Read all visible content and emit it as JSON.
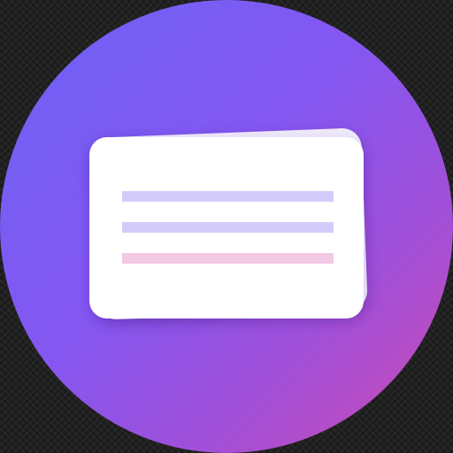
{
  "icon": {
    "name": "text-card-icon",
    "gradient": [
      "#6c63f5",
      "#8557f1",
      "#a14fd8",
      "#cf4ab2"
    ],
    "card_color": "#ffffff",
    "card_shadow_color": "#efe9fb",
    "lines": [
      {
        "color": "#d3ccfb"
      },
      {
        "color": "#d3ccfb"
      },
      {
        "color": "#f3c9e6"
      }
    ]
  }
}
